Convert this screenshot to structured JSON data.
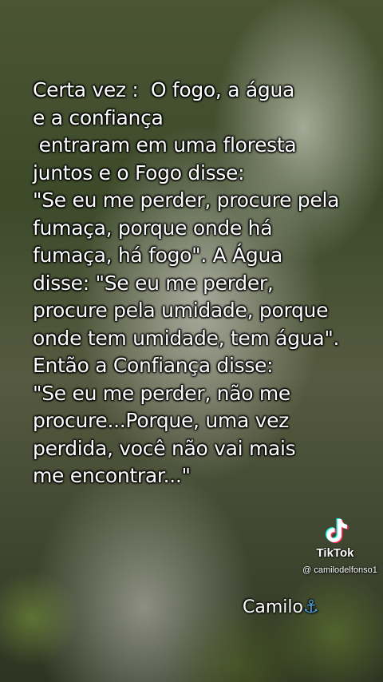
{
  "quote_lines": [
    "Certa vez :  O fogo, a água",
    "e a confiança",
    " entraram em uma floresta",
    "juntos e o Fogo disse:",
    "\"Se eu me perder, procure pela",
    "fumaça, porque onde há",
    "fumaça, há fogo\". A Água",
    "disse: \"Se eu me perder,",
    "procure pela umidade, porque",
    "onde tem umidade, tem água\".",
    "Então a Confiança disse:",
    "\"Se eu me perder, não me",
    "procure...Porque, uma vez",
    "perdida, você não vai mais",
    "me encontrar...\""
  ],
  "signature": {
    "name": "Camilo",
    "anchor": "⚓"
  },
  "watermark": {
    "brand": "TikTok",
    "handle": "@ camilodelfonso1",
    "icon": "tiktok-logo-icon"
  }
}
